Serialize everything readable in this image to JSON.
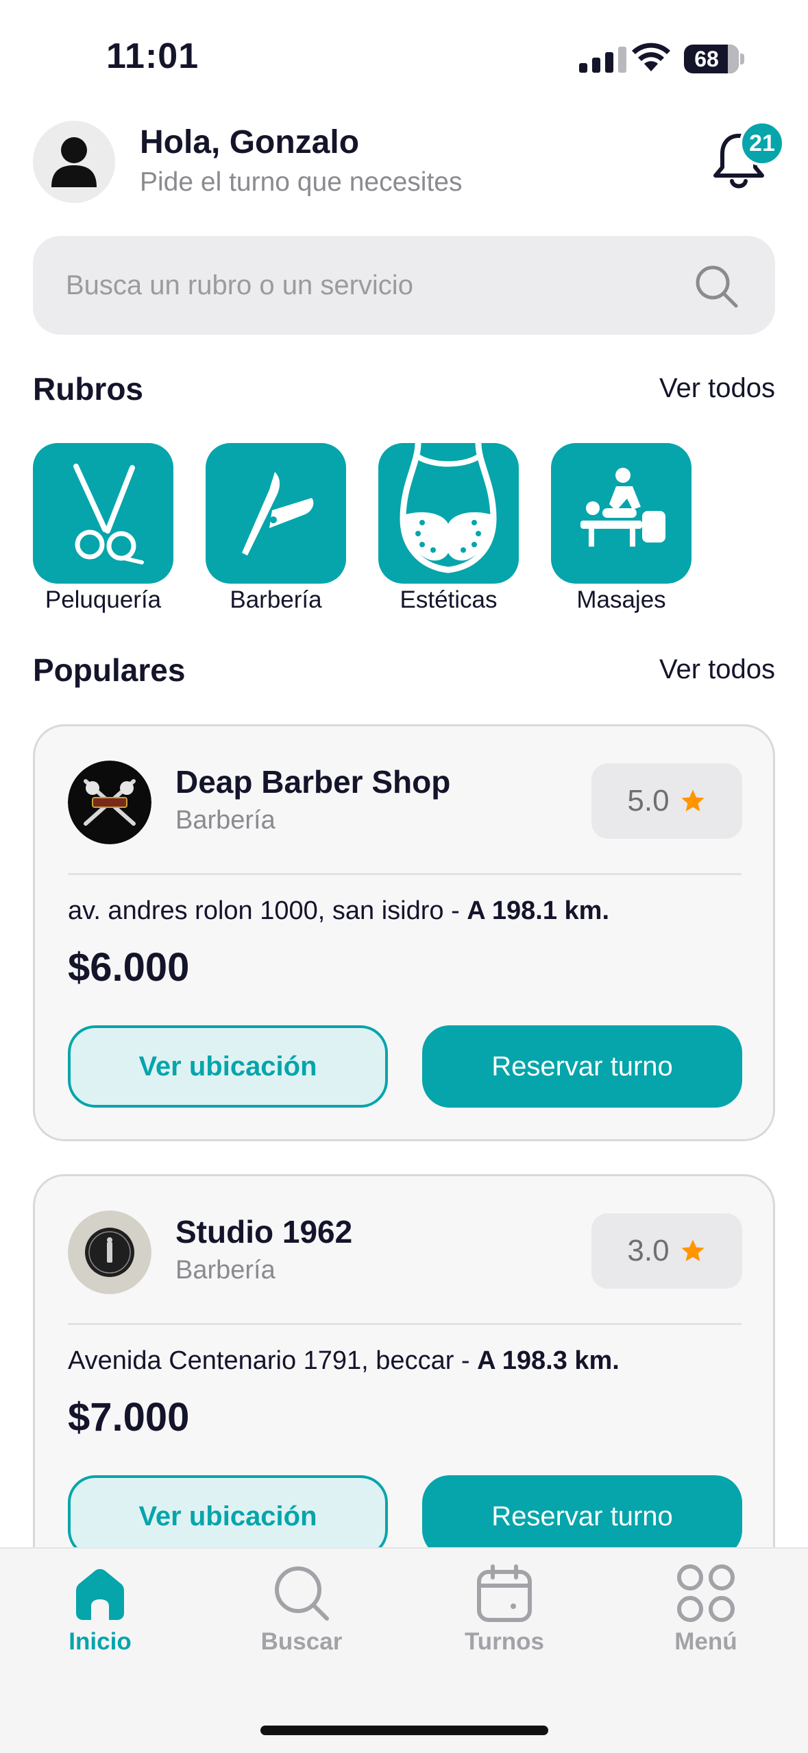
{
  "status_bar": {
    "time": "11:01",
    "battery": "68"
  },
  "header": {
    "greeting": "Hola, Gonzalo",
    "subtitle": "Pide el turno que necesites",
    "notifications": "21"
  },
  "search": {
    "placeholder": "Busca un rubro o un servicio",
    "value": ""
  },
  "categories_section": {
    "title": "Rubros",
    "see_all": "Ver todos",
    "items": [
      {
        "label": "Peluquería",
        "icon": "scissors-icon"
      },
      {
        "label": "Barbería",
        "icon": "razor-icon"
      },
      {
        "label": "Estéticas",
        "icon": "body-aesthetics-icon"
      },
      {
        "label": "Masajes",
        "icon": "massage-icon"
      }
    ]
  },
  "popular_section": {
    "title": "Populares",
    "see_all": "Ver todos",
    "shops": [
      {
        "name": "Deap Barber Shop",
        "category": "Barbería",
        "rating": "5.0",
        "address": "av. andres rolon 1000, san isidro - ",
        "distance": "A 198.1 km.",
        "price": "$6.000",
        "location_button": "Ver ubicación",
        "book_button": "Reservar turno"
      },
      {
        "name": "Studio 1962",
        "category": "Barbería",
        "rating": "3.0",
        "address": "Avenida Centenario 1791, beccar - ",
        "distance": "A 198.3 km.",
        "price": "$7.000",
        "location_button": "Ver ubicación",
        "book_button": "Reservar turno"
      }
    ]
  },
  "bottom_nav": {
    "items": [
      {
        "label": "Inicio",
        "icon": "home-icon",
        "active": true
      },
      {
        "label": "Buscar",
        "icon": "search-icon",
        "active": false
      },
      {
        "label": "Turnos",
        "icon": "calendar-icon",
        "active": false
      },
      {
        "label": "Menú",
        "icon": "grid-icon",
        "active": false
      }
    ]
  },
  "colors": {
    "accent": "#05a5ab",
    "star": "#ff9500",
    "text": "#14142b",
    "muted": "#8a8a8f"
  }
}
